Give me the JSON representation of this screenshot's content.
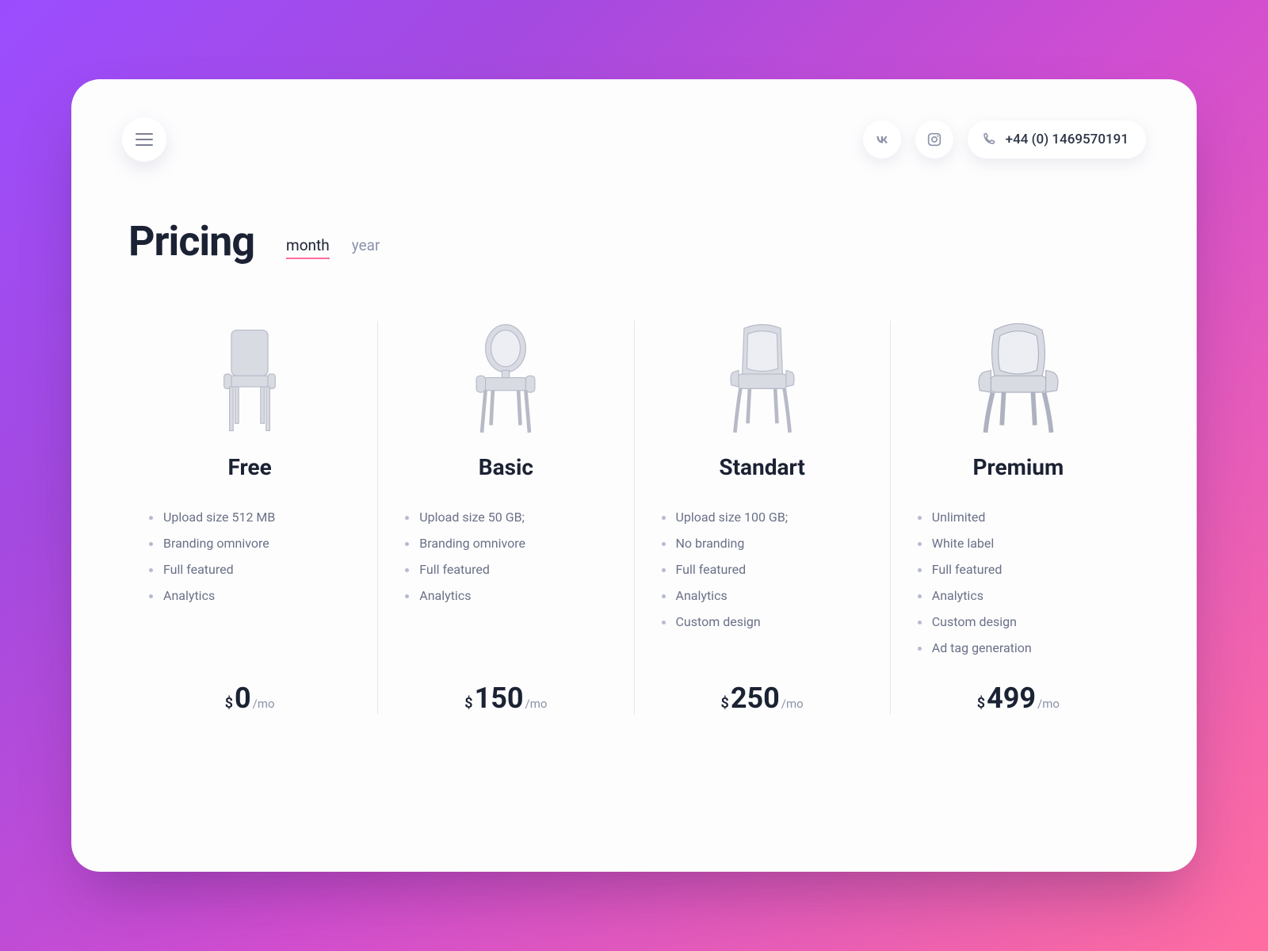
{
  "header": {
    "phone": "+44 (0) 1469570191"
  },
  "title": "Pricing",
  "billing_toggle": {
    "month_label": "month",
    "year_label": "year",
    "active": "month"
  },
  "currency": "$",
  "period_suffix": "/mo",
  "plans": [
    {
      "name": "Free",
      "price": "0",
      "features": [
        "Upload size 512 MB",
        "Branding omnivore",
        "Full featured",
        "Analytics"
      ]
    },
    {
      "name": "Basic",
      "price": "150",
      "features": [
        "Upload size 50 GB;",
        "Branding omnivore",
        "Full featured",
        "Analytics"
      ]
    },
    {
      "name": "Standart",
      "price": "250",
      "features": [
        "Upload size 100 GB;",
        "No branding",
        "Full featured",
        "Analytics",
        "Custom design"
      ]
    },
    {
      "name": "Premium",
      "price": "499",
      "features": [
        "Unlimited",
        "White label",
        "Full featured",
        "Analytics",
        "Custom design",
        "Ad tag generation"
      ]
    }
  ]
}
